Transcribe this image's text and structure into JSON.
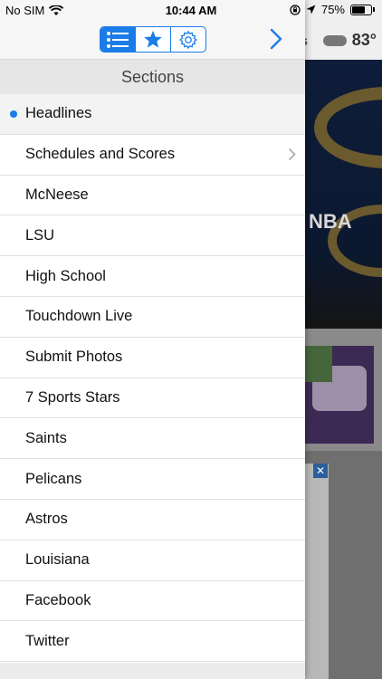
{
  "status_bar": {
    "carrier": "No SIM",
    "time": "10:44 AM",
    "battery": "75%",
    "battery_level": 0.75
  },
  "background": {
    "weather_partial": "s",
    "temperature": "83°",
    "hero_text": "NBA"
  },
  "header": {
    "segments": [
      "list-icon",
      "star-icon",
      "gear-icon"
    ],
    "active_segment": 0
  },
  "sections": {
    "title": "Sections",
    "items": [
      {
        "label": "Headlines"
      },
      {
        "label": "Schedules and Scores"
      },
      {
        "label": "McNeese"
      },
      {
        "label": "LSU"
      },
      {
        "label": "High School"
      },
      {
        "label": "Touchdown Live"
      },
      {
        "label": "Submit Photos"
      },
      {
        "label": "7 Sports Stars"
      },
      {
        "label": "Saints"
      },
      {
        "label": "Pelicans"
      },
      {
        "label": "Astros"
      },
      {
        "label": "Louisiana"
      },
      {
        "label": "Facebook"
      },
      {
        "label": "Twitter"
      }
    ]
  },
  "colors": {
    "accent": "#1a7ce6"
  }
}
